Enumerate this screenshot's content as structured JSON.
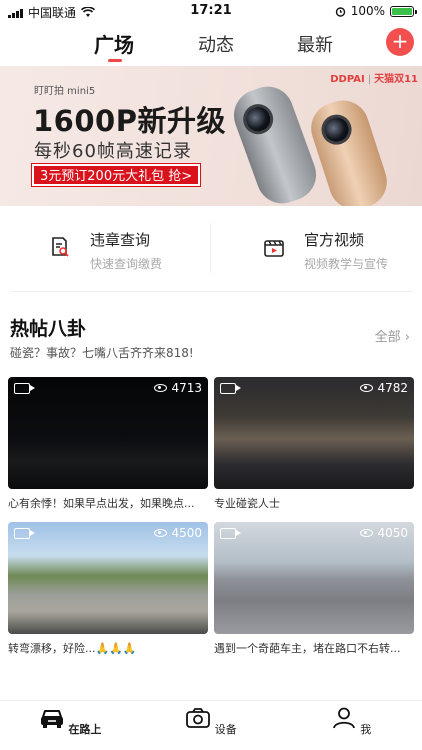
{
  "status_bar": {
    "carrier": "中国联通",
    "time": "17:21",
    "battery": "100%"
  },
  "header": {
    "tabs": [
      {
        "label": "广场",
        "active": true
      },
      {
        "label": "动态",
        "active": false
      },
      {
        "label": "最新",
        "active": false
      }
    ],
    "add_button_label": "+"
  },
  "banner": {
    "sub_brand": "盯盯拍 mini5",
    "brand": "DDPAI",
    "brand_campaign": "天猫双11",
    "headline": "1600P新升级",
    "tagline": "每秒60帧高速记录",
    "promo": "3元预订200元大礼包 抢>"
  },
  "quick_links": [
    {
      "title": "违章查询",
      "subtitle": "快速查询缴费",
      "icon": "document-search-icon"
    },
    {
      "title": "官方视频",
      "subtitle": "视频教学与宣传",
      "icon": "video-clapper-icon"
    }
  ],
  "section": {
    "title": "热帖八卦",
    "subtitle": "碰瓷？事故？七嘴八舌齐齐来818!",
    "more_label": "全部 ›"
  },
  "videos": [
    {
      "views": "4713",
      "caption": "心有余悸！如果早点出发，如果晚点..."
    },
    {
      "views": "4782",
      "caption": "专业碰瓷人士"
    },
    {
      "views": "4500",
      "caption": "转弯漂移，好险...🙏🙏🙏"
    },
    {
      "views": "4050",
      "caption": "遇到一个奇葩车主，堵在路口不右转..."
    }
  ],
  "bottom_nav": [
    {
      "label": "在路上",
      "icon": "car-icon",
      "active": true
    },
    {
      "label": "设备",
      "icon": "camera-icon",
      "active": false
    },
    {
      "label": "我",
      "icon": "person-icon",
      "active": false
    }
  ]
}
